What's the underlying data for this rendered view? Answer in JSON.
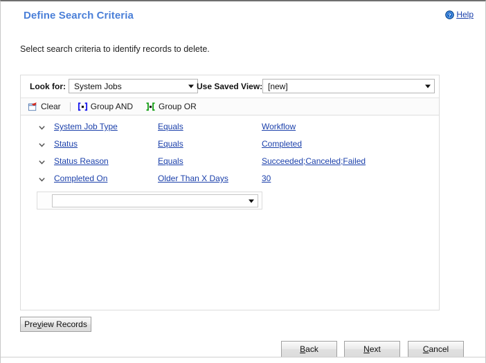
{
  "dialog": {
    "title": "Define Search Criteria",
    "subtitle": "Select search criteria to identify records to delete.",
    "help": {
      "icon": "help-circle-icon",
      "label": "Help",
      "accelerator": "H"
    }
  },
  "criteria_panel": {
    "look_for": {
      "label": "Look for:",
      "value": "System Jobs",
      "caret_icon": "chevron-down-icon"
    },
    "saved_view": {
      "label": "Use Saved View:",
      "value": "[new]",
      "caret_icon": "chevron-down-icon"
    },
    "toolbar": {
      "clear": {
        "icon": "clear-icon",
        "label": "Clear"
      },
      "group_and": {
        "icon": "group-and-icon",
        "label": "Group AND"
      },
      "group_or": {
        "icon": "group-or-icon",
        "label": "Group OR"
      }
    },
    "rows": [
      {
        "chevron_icon": "chevron-down-icon",
        "field": "System Job Type",
        "operator": "Equals",
        "value": "Workflow"
      },
      {
        "chevron_icon": "chevron-down-icon",
        "field": "Status",
        "operator": "Equals",
        "value": "Completed"
      },
      {
        "chevron_icon": "chevron-down-icon",
        "field": "Status Reason",
        "operator": "Equals",
        "value": "Succeeded;Canceled;Failed"
      },
      {
        "chevron_icon": "chevron-down-icon",
        "field": "Completed On",
        "operator": "Older Than X Days",
        "value": "30"
      }
    ],
    "new_row": {
      "value": "",
      "placeholder": "",
      "caret_icon": "chevron-down-icon"
    }
  },
  "buttons": {
    "preview_records": {
      "label": "Preview Records",
      "accelerator": "v"
    },
    "back": {
      "label": "Back",
      "accelerator": "B"
    },
    "next": {
      "label": "Next",
      "accelerator": "N"
    },
    "cancel": {
      "label": "Cancel",
      "accelerator": "C"
    }
  },
  "footer": {
    "left_text": "",
    "mid_text": "",
    "right_text": ""
  },
  "colors": {
    "title_blue": "#4a7fd8",
    "link_blue": "#1a3faa",
    "panel_border": "#dcdcdc",
    "group_and_green": "#1a1aee",
    "group_or_green": "#16a016",
    "clear_red": "#d52b1e"
  }
}
